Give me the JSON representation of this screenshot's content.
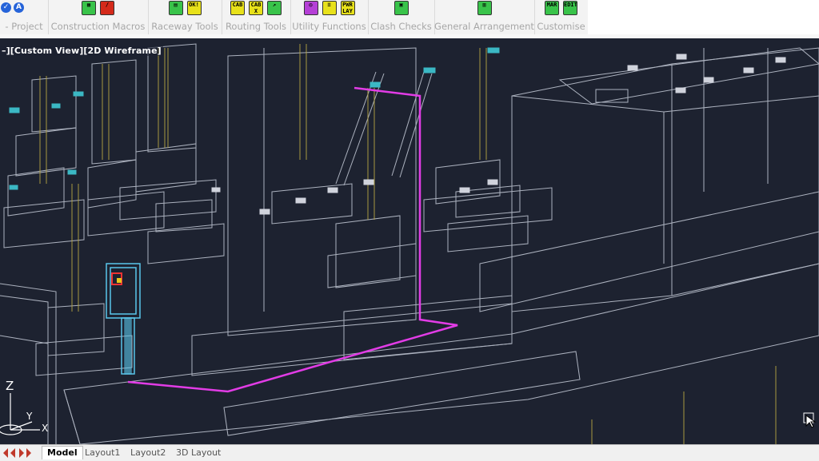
{
  "ribbon": {
    "panels": [
      {
        "label": "- Project",
        "icons": []
      },
      {
        "label": "Construction Macros",
        "icons": [
          {
            "name": "macro-grid-icon",
            "cls": "g",
            "text": "▦"
          },
          {
            "name": "macro-edit-icon",
            "cls": "r",
            "text": "/"
          }
        ]
      },
      {
        "label": "Raceway Tools",
        "icons": [
          {
            "name": "raceway-tool-icon",
            "cls": "g",
            "text": "▤"
          },
          {
            "name": "raceway-ok-icon",
            "cls": "y",
            "text": "OK!"
          }
        ]
      },
      {
        "label": "Routing Tools",
        "icons": [
          {
            "name": "cab-route-icon",
            "cls": "y",
            "text": "CAB"
          },
          {
            "name": "cab-x-icon",
            "cls": "y",
            "text": "CAB X"
          },
          {
            "name": "route-link-icon",
            "cls": "g",
            "text": "↗"
          }
        ]
      },
      {
        "label": "Utility Functions",
        "icons": [
          {
            "name": "utility-circle-icon",
            "cls": "p",
            "text": "◎"
          },
          {
            "name": "utility-list-icon",
            "cls": "y",
            "text": "≡"
          },
          {
            "name": "pwr-lay-icon",
            "cls": "y",
            "text": "PWR LAY"
          }
        ]
      },
      {
        "label": "Clash Checks",
        "icons": [
          {
            "name": "clash-check-icon",
            "cls": "g",
            "text": "▣"
          }
        ]
      },
      {
        "label": "General Arrangement",
        "icons": [
          {
            "name": "ga-layout-icon",
            "cls": "g",
            "text": "▥"
          }
        ]
      },
      {
        "label": "Customise",
        "icons": [
          {
            "name": "mar-icon",
            "cls": "g",
            "text": "MAR"
          },
          {
            "name": "edit-icon",
            "cls": "g",
            "text": "EDIT"
          }
        ]
      }
    ]
  },
  "viewport": {
    "label": "–][Custom View][2D Wireframe]",
    "axis_z": "Z",
    "axis_y": "Y",
    "axis_x": "X"
  },
  "layout_tabs": {
    "model": "Model",
    "layout1": "Layout1",
    "layout2": "Layout2",
    "layout3d": "3D Layout"
  },
  "colors": {
    "wire_gray": "#c6ccd8",
    "cable_magenta": "#e23ce6",
    "tray_yellow": "#b8a543",
    "panel_cyan": "#5ac6ea",
    "fixture_cyan": "#3bb8c4",
    "background": "#1d2230"
  }
}
